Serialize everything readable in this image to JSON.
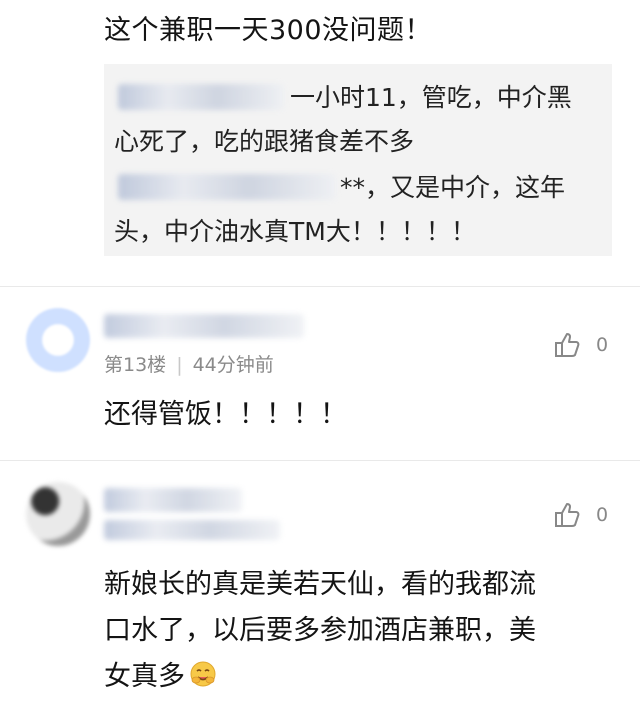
{
  "top_comment": {
    "text": "这个兼职一天300没问题！"
  },
  "quote": {
    "line1_rest": "一小时11，管吃，中介黑",
    "line2": "心死了，吃的跟猪食差不多",
    "line3_rest": "**，又是中介，这年",
    "line4": "头，中介油水真TM大！！！！！"
  },
  "comments": [
    {
      "floor": "第13楼",
      "time": "44分钟前",
      "likes": "0",
      "text": "还得管饭！！！！！"
    },
    {
      "likes": "0",
      "text_line1": "新娘长的真是美若天仙，看的我都流",
      "text_line2": "口水了，以后要多参加酒店兼职，美",
      "text_line3": "女真多"
    }
  ],
  "colors": {
    "quote_bg": "#f3f3f3",
    "meta": "#8a8a8a",
    "avatar_blue": "#cfe0ff"
  },
  "icons": [
    "like-icon",
    "emoji-icon"
  ]
}
